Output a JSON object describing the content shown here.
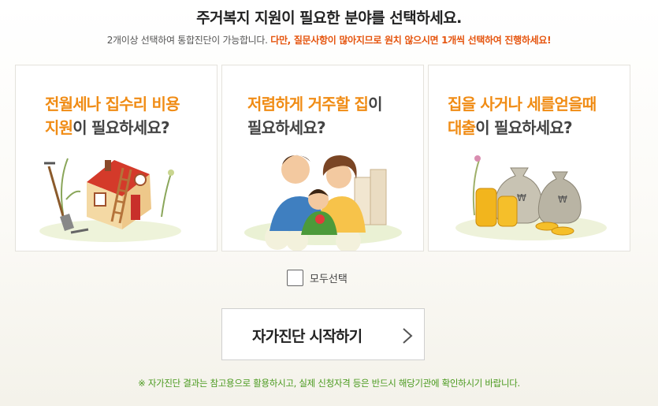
{
  "header": {
    "title": "주거복지 지원이 필요한 분야를 선택하세요.",
    "subtitle_plain": "2개이상 선택하여 통합진단이 가능합니다.",
    "subtitle_warn": "다만, 질문사항이 많아지므로 원치 않으시면 1개씩 선택하여 진행하세요!"
  },
  "cards": [
    {
      "title_hl_1": "전월세나 집수리 비용",
      "title_hl_2": "지원",
      "title_rest": "이 필요하세요?",
      "illustration": "house-illustration"
    },
    {
      "title_hl_1": "저렴하게 거주할 집",
      "title_rest_1": "이",
      "title_rest_2": "필요하세요?",
      "illustration": "family-illustration"
    },
    {
      "title_hl_1": "집을 사거나 세를얻을때",
      "title_hl_2": "대출",
      "title_rest": "이 필요하세요?",
      "illustration": "money-bags-illustration"
    }
  ],
  "select_all": {
    "label": "모두선택",
    "checked": false
  },
  "start_button": {
    "label": "자가진단 시작하기",
    "icon": "chevron-right-icon"
  },
  "notice": "※ 자가진단 결과는 참고용으로 활용하시고, 실제 신청자격 등은 반드시 해당기관에 확인하시기 바랍니다.",
  "colors": {
    "highlight": "#f08c15",
    "warning": "#e5550f",
    "notice": "#4a9a1e"
  }
}
